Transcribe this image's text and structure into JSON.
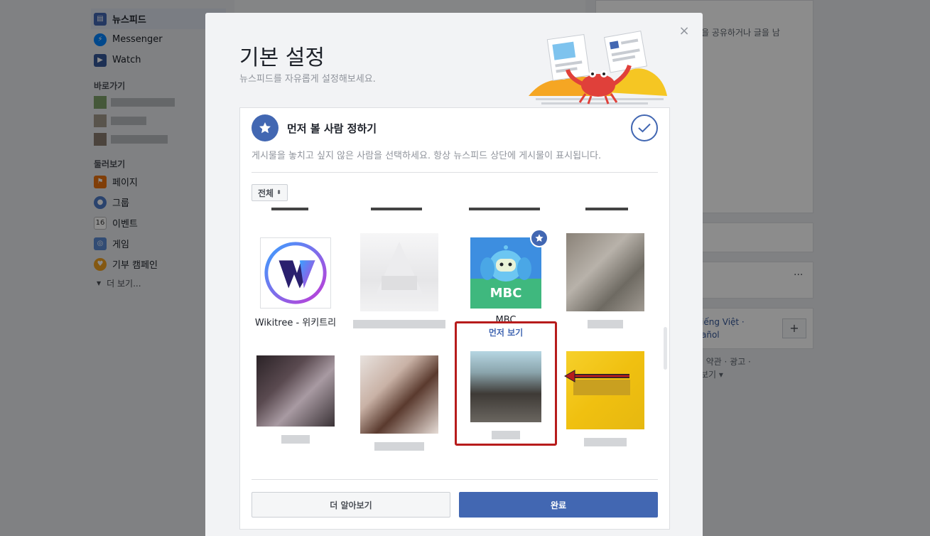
{
  "left_nav": {
    "items": [
      {
        "label": "뉴스피드",
        "icon": "newsfeed-icon"
      },
      {
        "label": "Messenger",
        "icon": "messenger-icon"
      },
      {
        "label": "Watch",
        "icon": "watch-icon"
      }
    ],
    "shortcuts_title": "바로가기",
    "explore_title": "둘러보기",
    "explore_items": [
      {
        "label": "페이지",
        "icon": "pages-flag-icon"
      },
      {
        "label": "그룹",
        "icon": "groups-icon"
      },
      {
        "label": "이벤트",
        "icon": "events-calendar-icon",
        "badge": "16"
      },
      {
        "label": "게임",
        "icon": "games-icon"
      },
      {
        "label": "기부 캠페인",
        "icon": "fundraiser-icon"
      }
    ],
    "more_label": "더 보기..."
  },
  "right_bg": {
    "text1": "을 공유하거나 글을 남",
    "text2": "iếng Việt ·",
    "text3": "añol",
    "text4": "· 약관 · 광고 ·",
    "text5": "보기 ▾",
    "more_dots": "···",
    "plus": "+"
  },
  "modal": {
    "title": "기본 설정",
    "subtitle": "뉴스피드를 자유롭게 설정해보세요.",
    "close": "×",
    "panel_title": "먼저 볼 사람 정하기",
    "panel_desc": "게시물을 놓치고 싶지 않은 사람을 선택하세요. 항상 뉴스피드 상단에 게시물이 표시됩니다.",
    "filter_label": "전체",
    "learn_more": "더 알아보기",
    "done": "완료"
  },
  "tiles": [
    {
      "name": "Wikitree - 위키트리",
      "logo": "wikitree-logo"
    },
    {
      "name": "",
      "blurred": true
    },
    {
      "name": "MBC",
      "sub": "먼저 보기",
      "logo": "mbc-logo",
      "selected": true
    },
    {
      "name": "",
      "blurred": true
    },
    {
      "name": "",
      "blurred": true
    },
    {
      "name": "",
      "blurred": true
    },
    {
      "name": "",
      "blurred": true
    },
    {
      "name": "",
      "blurred": true
    }
  ],
  "mbc_logo_text": "MBC",
  "colors": {
    "facebook_blue": "#4267b2",
    "highlight_red": "#b71c1c",
    "mbc_green": "#3fb87e"
  }
}
